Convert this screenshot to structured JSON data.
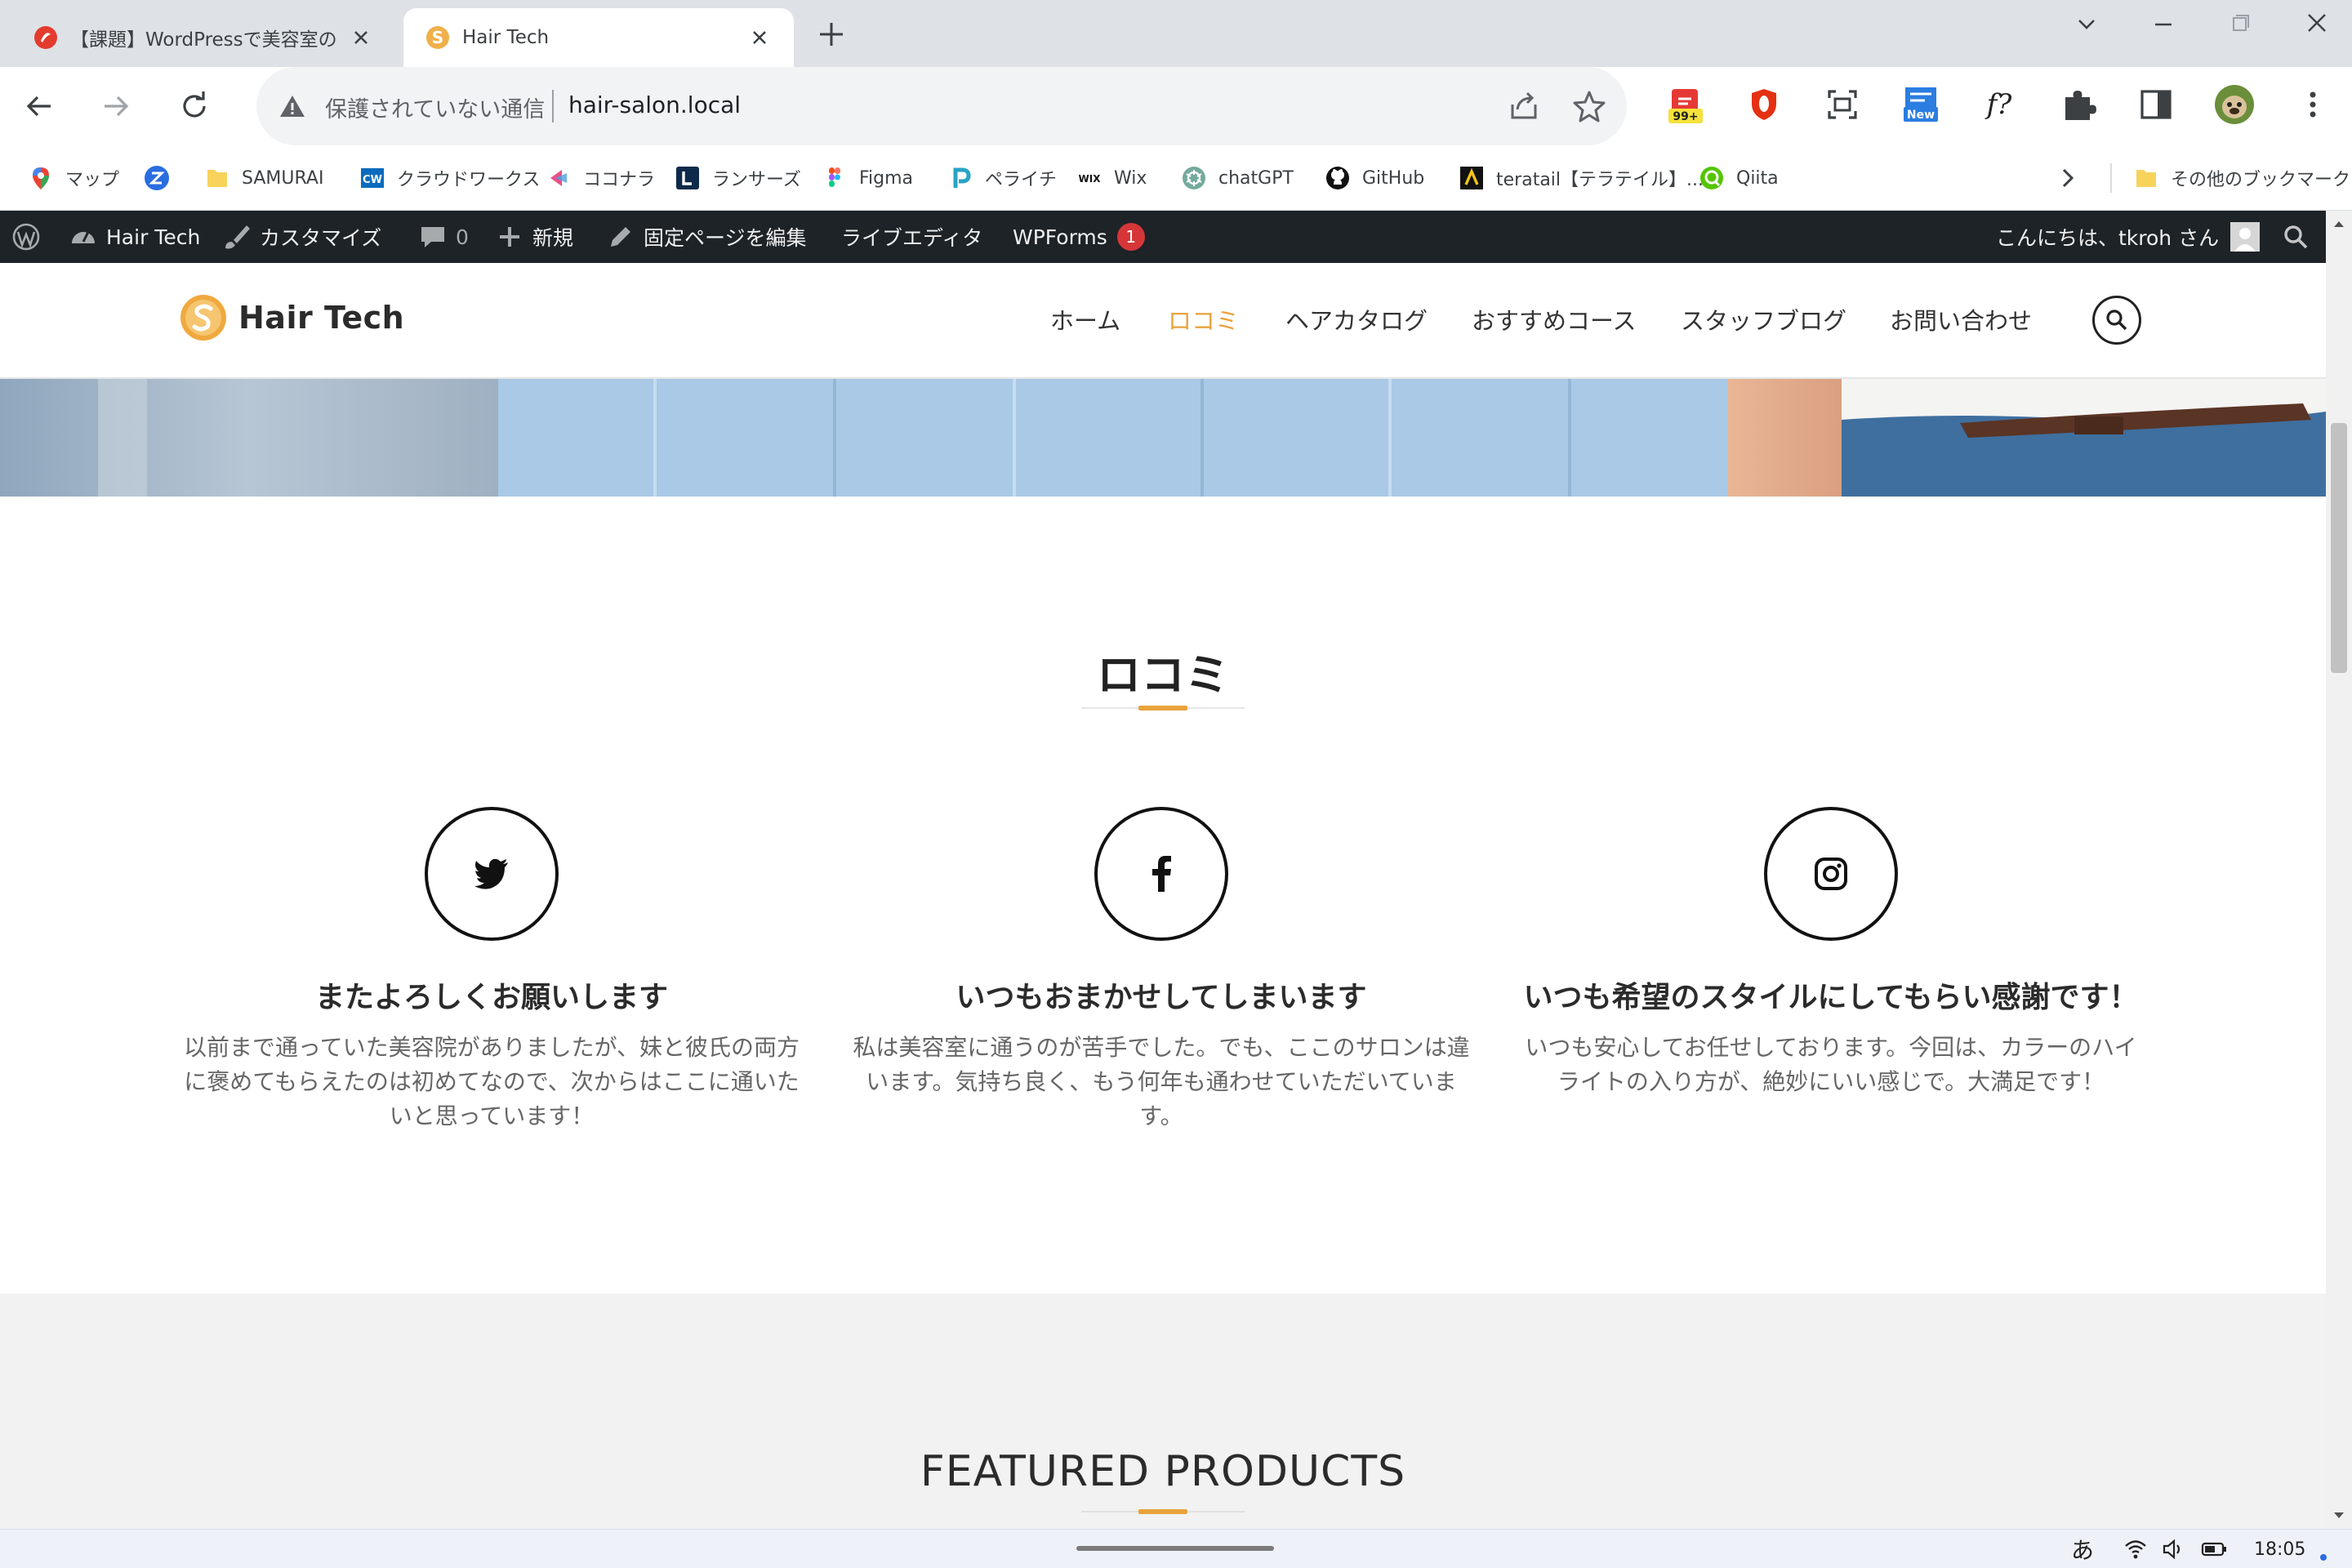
{
  "browser": {
    "tabs": [
      {
        "title": "【課題】WordPressで美容室のサイ",
        "active": false,
        "favicon": "samurai-icon"
      },
      {
        "title": "Hair Tech",
        "active": true,
        "favicon": "hair-tech-logo-icon"
      }
    ],
    "security_text": "保護されていない通信",
    "url": "hair-salon.local",
    "extension_badges": {
      "badge_99": "99+",
      "badge_new": "New",
      "formula": "f?"
    },
    "bookmarks": [
      {
        "label": "マップ",
        "icon": "maps-pin-icon"
      },
      {
        "label": "",
        "icon": "z-icon"
      },
      {
        "label": "SAMURAI",
        "icon": "folder-icon"
      },
      {
        "label": "クラウドワークス",
        "icon": "crowdworks-icon"
      },
      {
        "label": "ココナラ",
        "icon": "coconala-icon"
      },
      {
        "label": "ランサーズ",
        "icon": "lancers-icon"
      },
      {
        "label": "Figma",
        "icon": "figma-icon"
      },
      {
        "label": "ペライチ",
        "icon": "peraichi-icon"
      },
      {
        "label": "Wix",
        "icon": "wix-icon"
      },
      {
        "label": "chatGPT",
        "icon": "chatgpt-icon"
      },
      {
        "label": "GitHub",
        "icon": "github-icon"
      },
      {
        "label": "teratail【テラテイル】...",
        "icon": "teratail-icon"
      },
      {
        "label": "Qiita",
        "icon": "qiita-icon"
      }
    ],
    "other_bookmarks": "その他のブックマーク"
  },
  "adminbar": {
    "site_name": "Hair Tech",
    "customize": "カスタマイズ",
    "comments_count": "0",
    "new": "新規",
    "edit_page": "固定ページを編集",
    "live_editor": "ライブエディタ",
    "wpforms": "WPForms",
    "wpforms_badge": "1",
    "greeting": "こんにちは、tkroh さん"
  },
  "site": {
    "logo": "Hair Tech",
    "nav": [
      "ホーム",
      "ロコミ",
      "ヘアカタログ",
      "おすすめコース",
      "スタッフブログ",
      "お問い合わせ"
    ],
    "active_nav_index": 1,
    "reviews_title": "ロコミ",
    "reviews": [
      {
        "icon": "twitter-icon",
        "title": "またよろしくお願いします",
        "body": "以前まで通っていた美容院がありましたが、妹と彼氏の両方に褒めてもらえたのは初めてなので、次からはここに通いたいと思っています！"
      },
      {
        "icon": "facebook-icon",
        "title": "いつもおまかせしてしまいます",
        "body": "私は美容室に通うのが苦手でした。でも、ここのサロンは違います。気持ち良く、もう何年も通わせていただいています。"
      },
      {
        "icon": "instagram-icon",
        "title": "いつも希望のスタイルにしてもらい感謝です！",
        "body": "いつも安心してお任せしております。今回は、カラーのハイライトの入り方が、絶妙にいい感じで。大満足です！"
      }
    ],
    "products_title": "FEATURED PRODUCTS"
  },
  "taskbar": {
    "ime": "あ",
    "time": "18:05"
  },
  "colors": {
    "accent": "#e8a33c",
    "adminbar": "#1d2327",
    "tabstrip": "#dee1e6"
  }
}
